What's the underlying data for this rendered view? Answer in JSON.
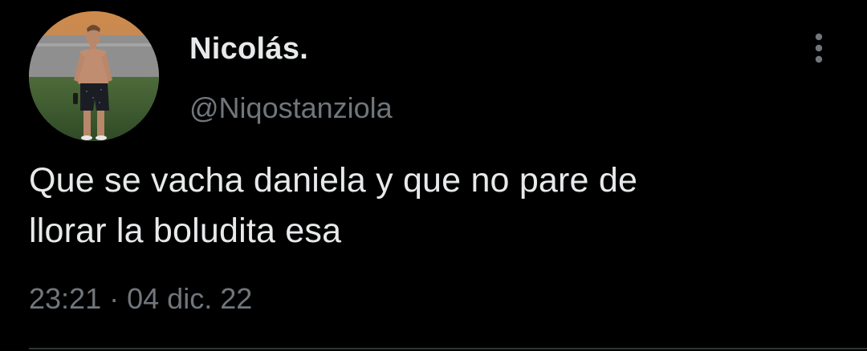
{
  "tweet": {
    "author": {
      "display_name": "Nicolás.",
      "handle": "@Niqostanziola",
      "avatar_icon": "profile-photo"
    },
    "more_icon": "more-vertical-icon",
    "text_lines": [
      "Que se vacha daniela y que no pare de",
      "llorar la boludita esa"
    ],
    "time": "23:21",
    "separator": "·",
    "date": "04 dic. 22"
  },
  "colors": {
    "background": "#000000",
    "primary_text": "#e7e9ea",
    "secondary_text": "#71767b",
    "divider": "#2f3336"
  }
}
